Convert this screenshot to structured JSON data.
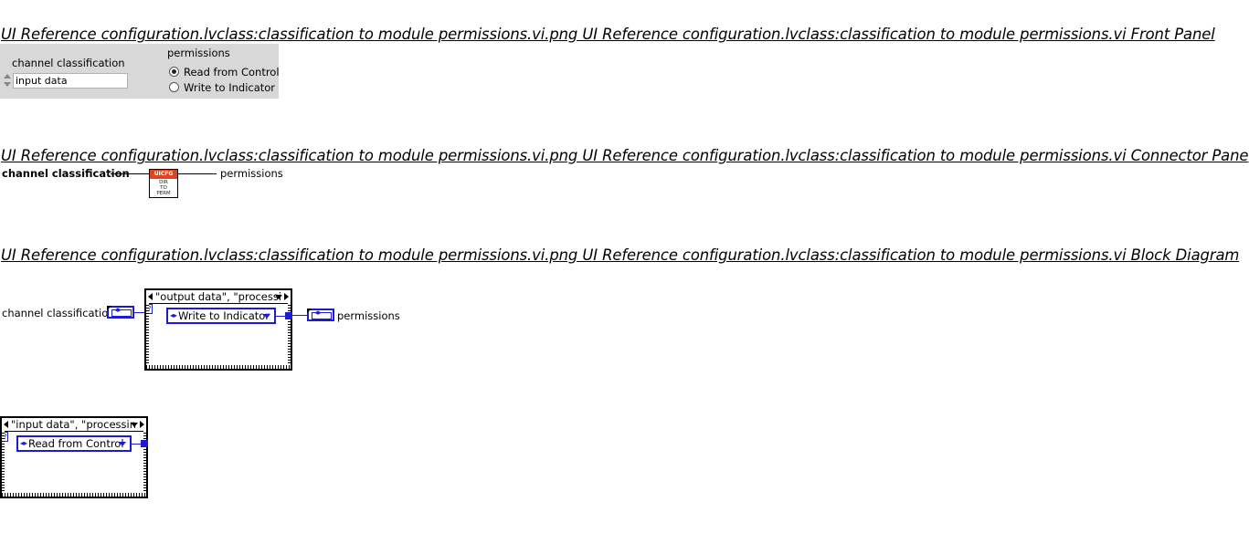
{
  "headings": {
    "front_panel": "UI Reference configuration.lvclass:classification to module permissions.vi.png  UI Reference configuration.lvclass:classification to module permissions.vi Front Panel",
    "connector_pane": "UI Reference configuration.lvclass:classification to module permissions.vi.png  UI Reference configuration.lvclass:classification to module permissions.vi Connector Pane",
    "block_diagram": "UI Reference configuration.lvclass:classification to module permissions.vi.png  UI Reference configuration.lvclass:classification to module permissions.vi Block Diagram"
  },
  "front_panel": {
    "control_label": "channel classification",
    "control_value": "input data",
    "indicator_label": "permissions",
    "options": [
      {
        "label": "Read from Control",
        "selected": true
      },
      {
        "label": "Write to Indicator",
        "selected": false
      }
    ]
  },
  "connector_pane": {
    "input": "channel classification",
    "output": "permissions",
    "icon_band": "UICFG",
    "icon_lines": [
      "DIR",
      "TO",
      "PERM"
    ],
    "icon_band_color": "#e0441f"
  },
  "block_diagram": {
    "input_label": "channel classification",
    "output_label": "permissions",
    "case1_selector": "\"output data\", \"processi",
    "case1_constant": "Write to Indicator",
    "case2_selector": "\"input data\", \"processin",
    "case2_constant": "Read from Control",
    "wire_color": "#1b1bd6"
  }
}
